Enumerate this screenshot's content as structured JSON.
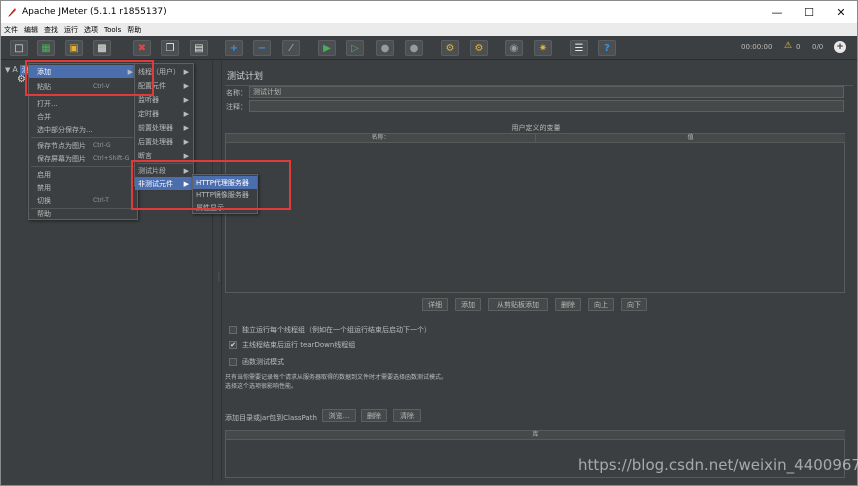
{
  "window": {
    "title": "Apache JMeter (5.1.1 r1855137)"
  },
  "menubar": [
    "文件",
    "编辑",
    "查找",
    "运行",
    "选项",
    "Tools",
    "帮助"
  ],
  "toolbar": {
    "timer": "00:00:00",
    "warn_count": "0",
    "ratio": "0/0"
  },
  "tree": {
    "root_label": "测试计划"
  },
  "context_menu": {
    "items": [
      {
        "label": "添加",
        "shortcut": ""
      },
      {
        "label": "粘贴",
        "shortcut": "Ctrl-V"
      },
      {
        "label": "打开...",
        "shortcut": ""
      },
      {
        "label": "合并",
        "shortcut": ""
      },
      {
        "label": "选中部分保存为...",
        "shortcut": ""
      },
      {
        "label": "保存节点为图片",
        "shortcut": "Ctrl-G"
      },
      {
        "label": "保存屏幕为图片",
        "shortcut": "Ctrl+Shift-G"
      },
      {
        "label": "启用",
        "shortcut": ""
      },
      {
        "label": "禁用",
        "shortcut": ""
      },
      {
        "label": "切换",
        "shortcut": "Ctrl-T"
      },
      {
        "label": "帮助",
        "shortcut": ""
      }
    ]
  },
  "submenu_add": {
    "items": [
      "线程（用户）",
      "配置元件",
      "监听器",
      "定时器",
      "前置处理器",
      "后置处理器",
      "断言",
      "测试片段",
      "非测试元件"
    ]
  },
  "submenu_nontest": {
    "items": [
      "HTTP代理服务器",
      "HTTP镜像服务器",
      "属性显示"
    ]
  },
  "test_plan": {
    "section_title": "测试计划",
    "name_label": "名称：",
    "name_value": "测试计划",
    "comment_label": "注释：",
    "comment_value": "",
    "vars_title": "用户定义的变量",
    "col_name": "名称：",
    "col_value": "值",
    "buttons": [
      "详细",
      "添加",
      "从剪贴板添加",
      "删除",
      "向上",
      "向下"
    ],
    "checkbox1_label": "独立运行每个线程组（例如在一个组运行结束后启动下一个）",
    "checkbox1_checked": false,
    "checkbox2_label": "主线程结束后运行 tearDown线程组",
    "checkbox2_checked": true,
    "checkbox3_label": "函数测试模式",
    "checkbox3_checked": false,
    "note_line1": "只有当你需要记录每个请求从服务器取得的数据到文件时才需要选择函数测试模式。",
    "note_line2": "选择这个选项很影响性能。",
    "classpath_label": "添加目录或jar包到ClassPath",
    "classpath_buttons": [
      "浏览...",
      "删除",
      "清除"
    ],
    "library_col": "库"
  },
  "watermark": "https://blog.csdn.net/weixin_44009675"
}
